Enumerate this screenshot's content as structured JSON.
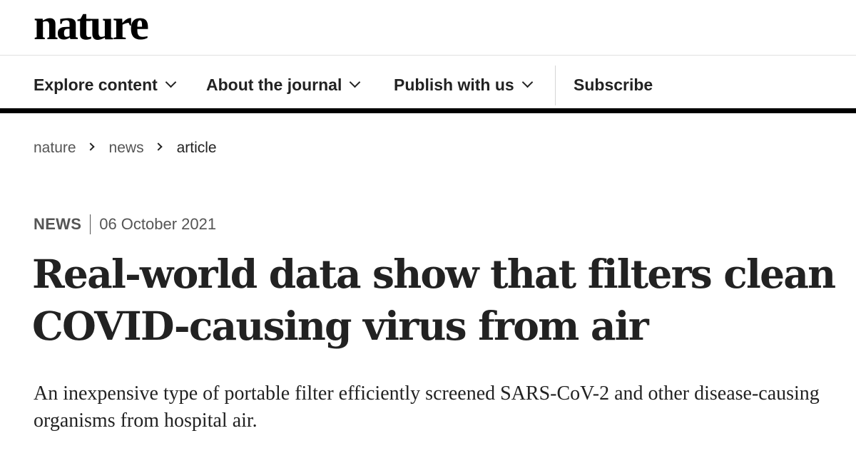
{
  "site": {
    "logo": "nature"
  },
  "nav": {
    "items": [
      {
        "label": "Explore content",
        "has_dropdown": true
      },
      {
        "label": "About the journal",
        "has_dropdown": true
      },
      {
        "label": "Publish with us",
        "has_dropdown": true
      }
    ],
    "subscribe_label": "Subscribe"
  },
  "breadcrumb": [
    "nature",
    "news",
    "article"
  ],
  "article": {
    "type": "NEWS",
    "date": "06 October 2021",
    "title": "Real-world data show that filters clean COVID-causing virus from air",
    "standfirst": "An inexpensive type of portable filter efficiently screened SARS-CoV-2 and other disease-causing organisms from hospital air."
  },
  "icons": [
    "chevron-down-icon",
    "chevron-right-icon"
  ],
  "colors": {
    "text": "#222222",
    "muted": "#555555",
    "nav_rule": "#000000",
    "divider": "#e0e0e0"
  }
}
